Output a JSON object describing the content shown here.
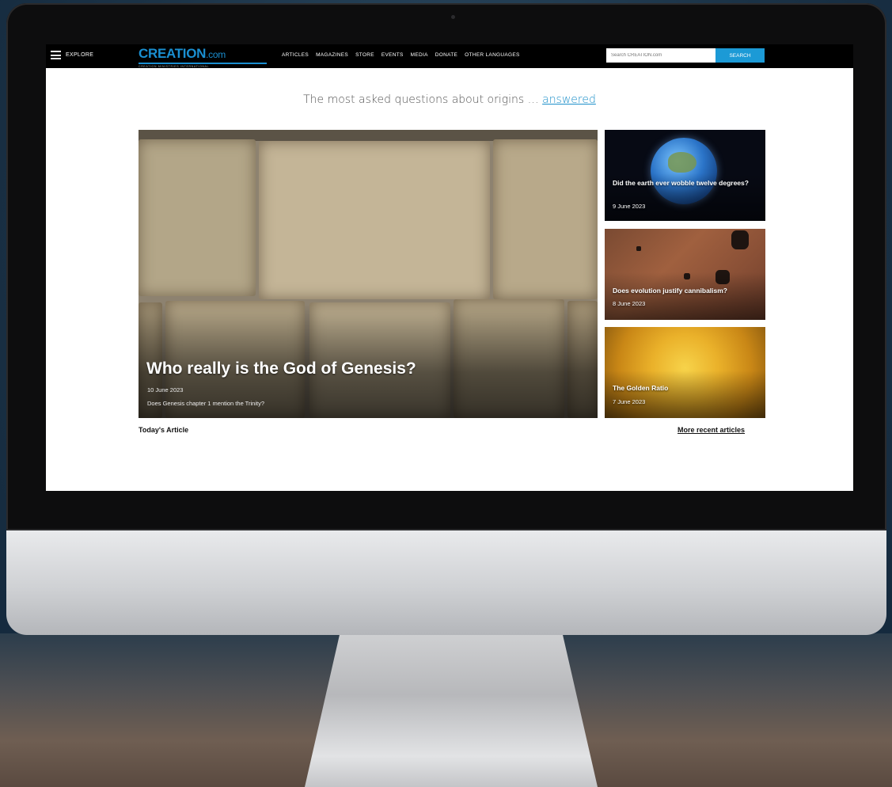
{
  "navbar": {
    "explore_label": "EXPLORE",
    "logo_text": "CREATION",
    "logo_suffix": ".com",
    "logo_subtitle": "CREATION MINISTRIES INTERNATIONAL",
    "links": [
      "ARTICLES",
      "MAGAZINES",
      "STORE",
      "EVENTS",
      "MEDIA",
      "DONATE",
      "OTHER LANGUAGES"
    ],
    "search_placeholder": "Search CREATION.com",
    "search_button": "SEARCH"
  },
  "tagline": {
    "text": "The most asked questions about origins … ",
    "link": "answered"
  },
  "hero": {
    "title": "Who really is the God of Genesis?",
    "date": "10 June 2023",
    "subtitle": "Does Genesis chapter 1 mention the Trinity?"
  },
  "side_articles": [
    {
      "title": "Did the earth ever wobble twelve degrees?",
      "date": "9 June 2023"
    },
    {
      "title": "Does evolution justify cannibalism?",
      "date": "8 June 2023"
    },
    {
      "title": "The Golden Ratio",
      "date": "7 June 2023"
    }
  ],
  "footer_links": {
    "todays": "Today's Article",
    "more": "More recent articles"
  },
  "colors": {
    "accent": "#1c9ad6",
    "nav_background": "#000000",
    "background": "#1b3347"
  }
}
